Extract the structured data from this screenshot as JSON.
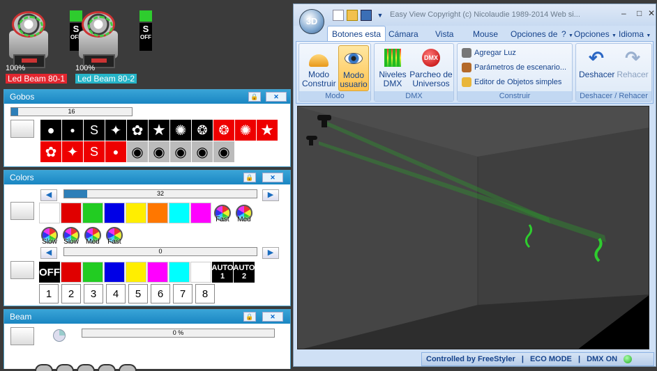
{
  "fixtures": [
    {
      "percent": "100%",
      "name": "Led Beam 80-1",
      "color": "#e3262f",
      "off": "OFF",
      "sym": "S"
    },
    {
      "percent": "100%",
      "name": "Led Beam 80-2",
      "color": "#26b5c8",
      "off": "OFF",
      "sym": "S"
    }
  ],
  "gobos": {
    "title": "Gobos",
    "slider_value": "16",
    "slider_fraction": 0.06
  },
  "colors": {
    "title": "Colors",
    "slider1_value": "32",
    "slider1_fraction": 0.12,
    "slider2_value": "0",
    "row1": [
      "#ffffff",
      "#e00000",
      "#22cc22",
      "#0000e6",
      "#ffee00",
      "#ff7700",
      "#00ffff",
      "#ff00ff"
    ],
    "wheel_labels_row1": [
      "Fast",
      "Med"
    ],
    "wheel_labels_row2": [
      "Slow",
      "Slow",
      "Med",
      "Fast"
    ],
    "off_label": "OFF",
    "row2": [
      "#e00000",
      "#22cc22",
      "#0000e6",
      "#ffee00",
      "#ff00ff",
      "#00ffff",
      "#ffffff"
    ],
    "auto1": "AUTO 1",
    "auto2": "AUTO 2",
    "numbers": [
      "1",
      "2",
      "3",
      "4",
      "5",
      "6",
      "7",
      "8"
    ]
  },
  "beam": {
    "title": "Beam",
    "slider_value": "0 %"
  },
  "window": {
    "orb": "3D",
    "title": "Easy View   Copyright (c) Nicolaudie 1989-2014   Web si...",
    "tabs": [
      "Botones esta",
      "Cámara",
      "Vista",
      "Mouse",
      "Opciones de"
    ],
    "help": "?",
    "opciones": "Opciones",
    "idioma": "Idioma",
    "groups": {
      "modo": {
        "label": "Modo",
        "construir": "Modo Construir",
        "usuario": "Modo usuario"
      },
      "dmx": {
        "label": "DMX",
        "niveles": "Niveles DMX",
        "parcheo": "Parcheo de Universos"
      },
      "construir": {
        "label": "Construir",
        "agregar": "Agregar Luz",
        "parametros": "Parámetros de escenario...",
        "editor": "Editor de Objetos simples"
      },
      "deshacer": {
        "label": "Deshacer / Rehacer",
        "deshacer": "Deshacer",
        "rehacer": "Rehacer"
      }
    },
    "status": {
      "controlled": "Controlled by FreeStyler",
      "eco": "ECO MODE",
      "dmx": "DMX ON",
      "sep": "|"
    }
  }
}
